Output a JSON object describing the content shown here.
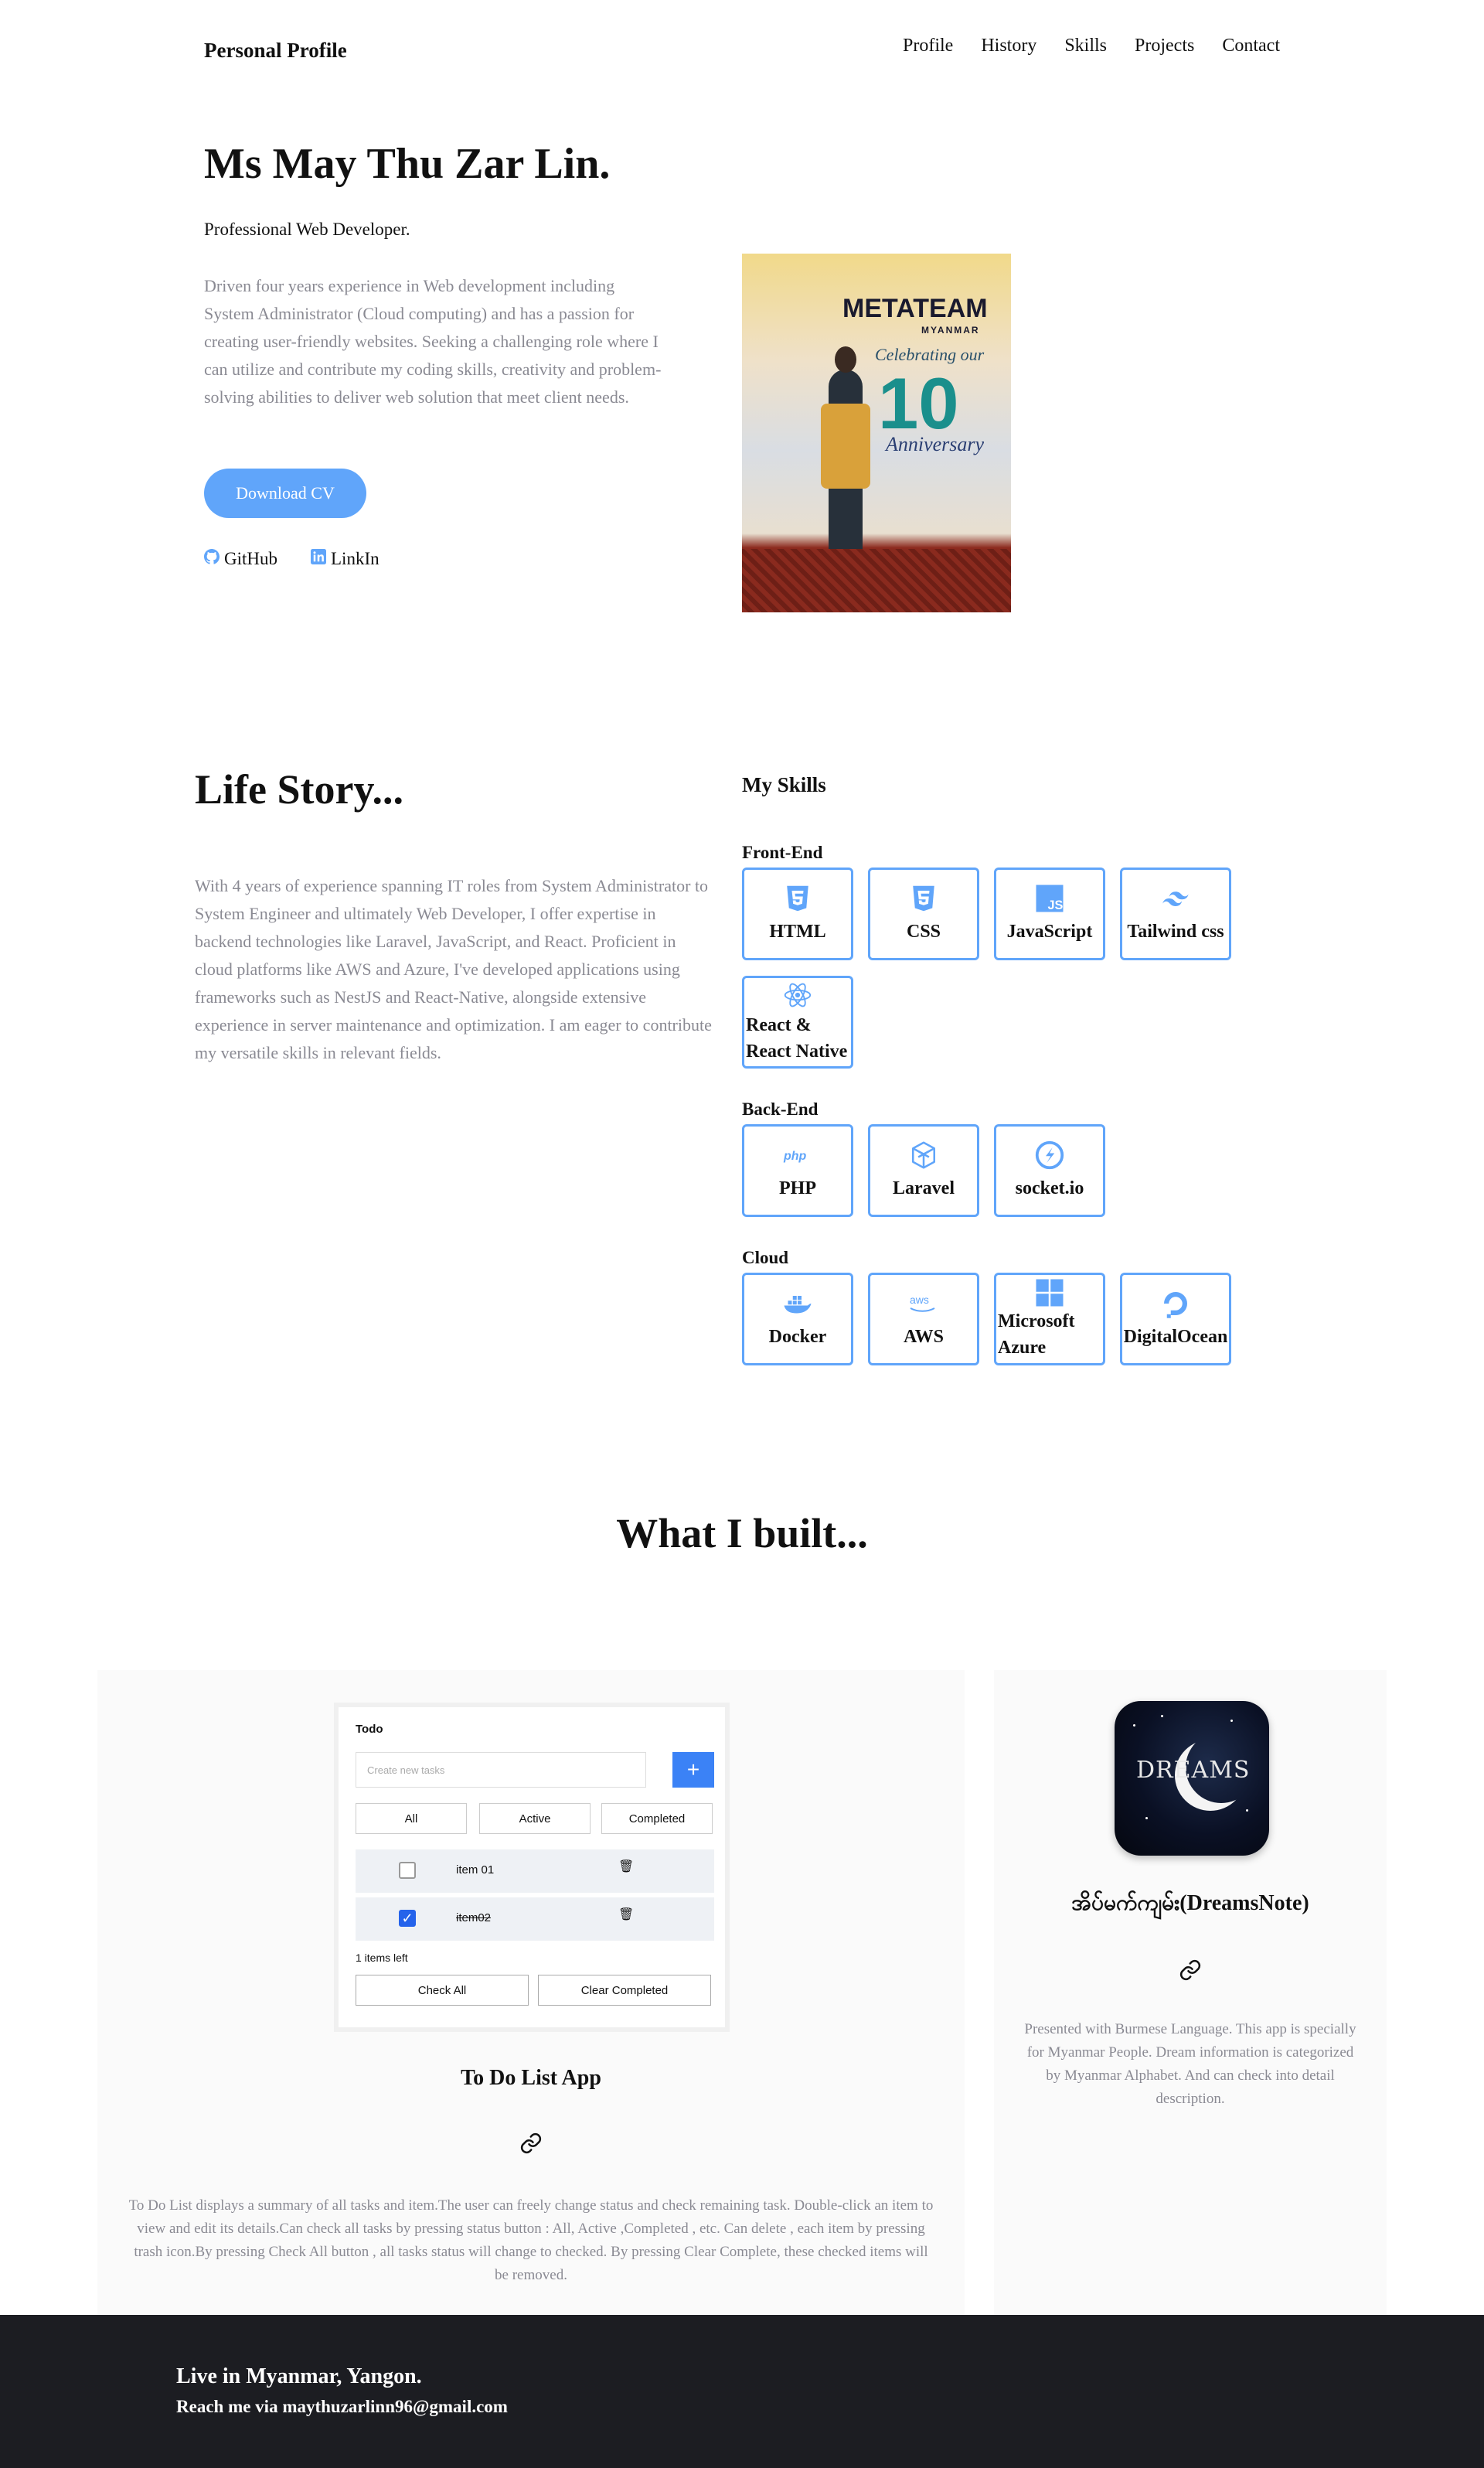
{
  "header": {
    "brand": "Personal Profile",
    "nav": [
      "Profile",
      "History",
      "Skills",
      "Projects",
      "Contact"
    ]
  },
  "hero": {
    "name": "Ms May Thu Zar Lin.",
    "role": "Professional Web Developer.",
    "description": "Driven four years experience in Web development including System Administrator (Cloud computing) and has a passion for creating user-friendly websites. Seeking a challenging role where I can utilize and contribute my coding skills, creativity and problem-solving abilities to deliver web solution that meet client needs.",
    "cv_button": "Download CV",
    "links": [
      {
        "label": "GitHub",
        "icon": "github-icon"
      },
      {
        "label": "LinkIn",
        "icon": "linkedin-icon"
      }
    ],
    "photo": {
      "banner": "METATEAM",
      "banner_sub": "MYANMAR",
      "celebrating": "Celebrating our",
      "number": "10",
      "anniversary": "Anniversary"
    }
  },
  "life": {
    "title": "Life Story...",
    "text": "With 4 years of experience spanning IT roles from System Administrator to System Engineer and ultimately Web Developer, I offer expertise in backend technologies like Laravel, JavaScript, and React. Proficient in cloud platforms like AWS and Azure, I've developed applications using frameworks such as NestJS and React-Native, alongside extensive experience in server maintenance and optimization. I am eager to contribute my versatile skills in relevant fields."
  },
  "skills": {
    "title": "My Skills",
    "categories": [
      {
        "label": "Front-End",
        "items": [
          {
            "label": "HTML",
            "icon": "html5-icon"
          },
          {
            "label": "CSS",
            "icon": "css3-icon"
          },
          {
            "label": "JavaScript",
            "icon": "javascript-icon"
          },
          {
            "label": "Tailwind css",
            "icon": "tailwind-icon"
          },
          {
            "label": "React & React Native",
            "icon": "react-icon"
          }
        ]
      },
      {
        "label": "Back-End",
        "items": [
          {
            "label": "PHP",
            "icon": "php-icon"
          },
          {
            "label": "Laravel",
            "icon": "laravel-icon"
          },
          {
            "label": "socket.io",
            "icon": "socketio-icon"
          }
        ]
      },
      {
        "label": "Cloud",
        "items": [
          {
            "label": "Docker",
            "icon": "docker-icon"
          },
          {
            "label": "AWS",
            "icon": "aws-icon"
          },
          {
            "label": "Microsoft Azure",
            "icon": "windows-icon"
          },
          {
            "label": "DigitalOcean",
            "icon": "digitalocean-icon"
          }
        ]
      }
    ],
    "accent": "#60a5fa"
  },
  "projects": {
    "title": "What I built...",
    "items": [
      {
        "title": "To Do List App",
        "description": "To Do List displays a summary of all tasks and item.The user can freely change status and check remaining task. Double-click an item to view and edit its details.Can check all tasks by pressing status button : All, Active ,Completed , etc. Can delete , each item by pressing trash icon.By pressing Check All button , all tasks status will change to checked. By pressing Clear Complete, these checked items will be removed.",
        "screenshot": {
          "title": "Todo",
          "placeholder": "Create new tasks",
          "add": "+",
          "filters": [
            "All",
            "Active",
            "Completed"
          ],
          "tasks": [
            {
              "label": "item 01",
              "done": false
            },
            {
              "label": "item02",
              "done": true
            }
          ],
          "items_left": "1 items left",
          "check_all": "Check All",
          "clear_completed": "Clear Completed"
        }
      },
      {
        "title": "အိပ်မက်ကျမ်း(DreamsNote)",
        "icon_text": "DREAMS",
        "description": "Presented with Burmese Language. This app is specially for Myanmar People. Dream information is categorized by Myanmar Alphabet. And can check into detail description."
      }
    ]
  },
  "footer": {
    "line1": "Live in Myanmar, Yangon.",
    "line2": "Reach me via maythuzarlinn96@gmail.com"
  }
}
